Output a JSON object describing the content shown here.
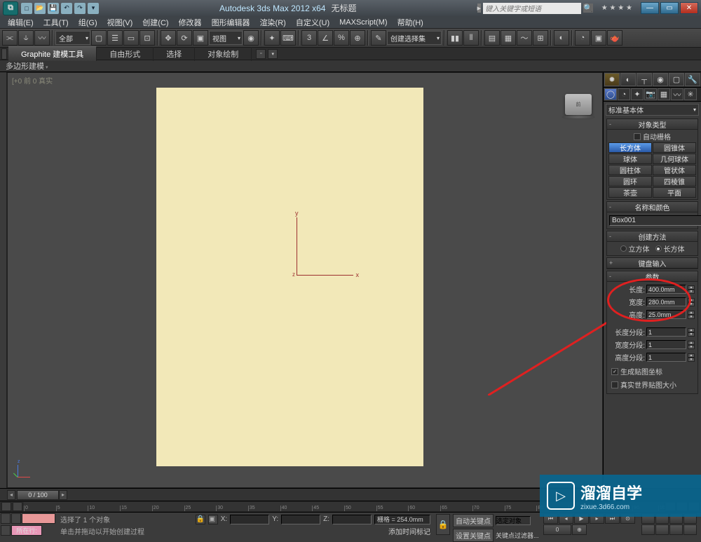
{
  "title": {
    "app": "Autodesk 3ds Max 2012 x64",
    "file": "无标题"
  },
  "search_placeholder": "键入关键字或短语",
  "menu": [
    "编辑(E)",
    "工具(T)",
    "组(G)",
    "视图(V)",
    "创建(C)",
    "修改器",
    "图形编辑器",
    "渲染(R)",
    "自定义(U)",
    "MAXScript(M)",
    "帮助(H)"
  ],
  "toolbar": {
    "sel_filter": "全部",
    "refcoord": "视图",
    "named_sel": "创建选择集"
  },
  "ribbon": {
    "tabs": [
      "Graphite 建模工具",
      "自由形式",
      "选择",
      "对象绘制"
    ],
    "sub": "多边形建模"
  },
  "viewport": {
    "label": "[+0 前 0 真实"
  },
  "viewcube_face": "前",
  "cmd": {
    "dropdown": "标准基本体",
    "rollouts": {
      "obj_type": "对象类型",
      "auto_grid": "自动栅格",
      "name_color": "名称和颜色",
      "cre_method": "创建方法",
      "kb_entry": "键盘输入",
      "params": "参数"
    },
    "primitives": [
      "长方体",
      "圆锥体",
      "球体",
      "几何球体",
      "圆柱体",
      "管状体",
      "圆环",
      "四棱锥",
      "茶壶",
      "平面"
    ],
    "obj_name": "Box001",
    "cre_radio": [
      "立方体",
      "长方体"
    ],
    "dims": {
      "length_l": "长度:",
      "length_v": "400.0mm",
      "width_l": "宽度:",
      "width_v": "280.0mm",
      "height_l": "高度:",
      "height_v": "25.0mm"
    },
    "segs": {
      "ls_l": "长度分段:",
      "ls_v": "1",
      "ws_l": "宽度分段:",
      "ws_v": "1",
      "hs_l": "高度分段:",
      "hs_v": "1"
    },
    "gen_map": "生成贴图坐标",
    "real_world": "真实世界贴图大小"
  },
  "time": {
    "slider": "0 / 100"
  },
  "status": {
    "sel": "选择了 1 个对象",
    "prompt": "单击并拖动以开始创建过程",
    "xl": "X:",
    "yl": "Y:",
    "zl": "Z:",
    "grid": "栅格 = 254.0mm",
    "add_tag": "添加时间标记",
    "auto_key": "自动关键点",
    "sel_key": "选定对象",
    "set_key": "设置关键点",
    "key_filter": "关键点过滤器...",
    "here": "所在行:"
  },
  "watermark": {
    "main": "溜溜自学",
    "sub": "zixue.3d66.com"
  }
}
